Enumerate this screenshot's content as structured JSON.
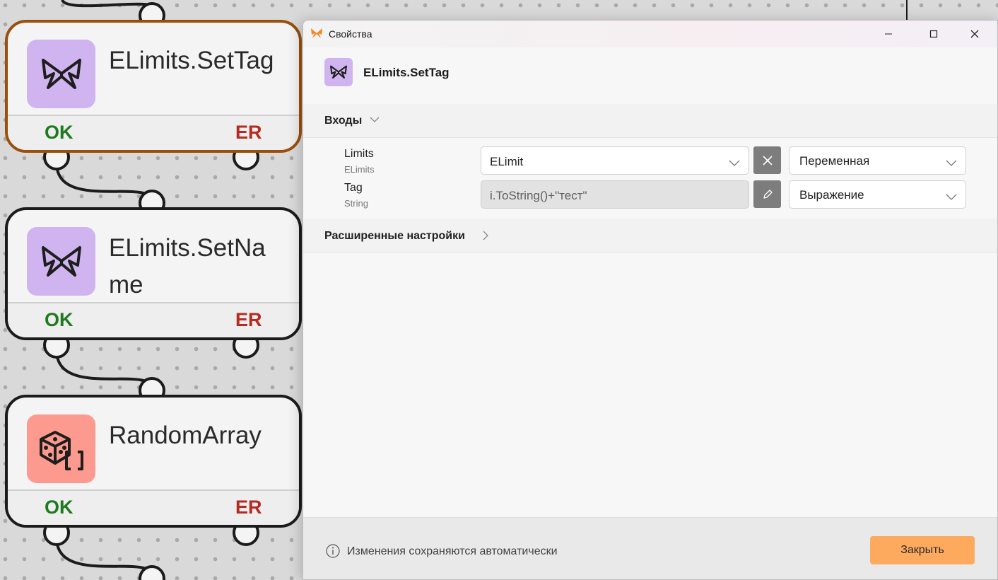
{
  "nodes": [
    {
      "title": "ELimits.SetTag",
      "icon": "butterfly-icon",
      "icon_bg": "#cfb4ef",
      "ok_label": "OK",
      "er_label": "ER",
      "selected": true
    },
    {
      "title": "ELimits.SetName",
      "icon": "butterfly-icon",
      "icon_bg": "#cfb4ef",
      "ok_label": "OK",
      "er_label": "ER",
      "selected": false
    },
    {
      "title": "RandomArray",
      "icon": "dice-array-icon",
      "icon_bg": "#fd9a8f",
      "ok_label": "OK",
      "er_label": "ER",
      "selected": false
    }
  ],
  "dialog": {
    "window_title": "Свойства",
    "header_title": "ELimits.SetTag",
    "inputs_section": "Входы",
    "params": [
      {
        "name": "Limits",
        "type": "ELimits",
        "value": "ELimit",
        "mode": "Переменная",
        "readonly": false,
        "action_icon": "clear-icon"
      },
      {
        "name": "Tag",
        "type": "String",
        "value": "i.ToString()+\"тест\"",
        "mode": "Выражение",
        "readonly": true,
        "action_icon": "pencil-icon"
      }
    ],
    "advanced_section": "Расширенные настройки",
    "footer_note": "Изменения сохраняются автоматически",
    "close_label": "Закрыть"
  },
  "colors": {
    "accent": "#fdaa5f",
    "selected_border": "#9a4f0c",
    "ok": "#1f7a1f",
    "er": "#b52b22"
  }
}
